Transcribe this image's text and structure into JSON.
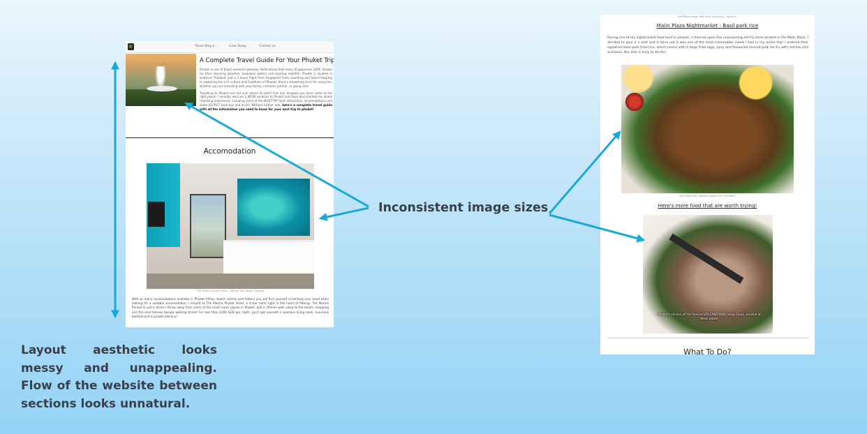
{
  "annotations": {
    "image_sizes_label": "Inconsistent image sizes",
    "layout_note": "Layout aesthetic looks messy and unappealing. Flow of the website between sections looks unnatural.",
    "arrow_color": "#1aa7d9"
  },
  "left_mockup": {
    "nav": {
      "items": [
        "Travel Blog",
        "Case Study",
        "Contact Us"
      ]
    },
    "title": "A Complete Travel Guide For Your Phuket Trip",
    "intro_p1": "Phuket is one of those weekend getaway destinations that every Singaporean LOVE. Known for their stunning beaches, turquoise waters and buzzing nightlife, Phuket is located in southern Thailand, just a 2 hours flight from Singapore! From snorkling and island hopping to exploring the rich culture and traditions of Phuket, there's something here for everyone, whether you are travelling with your family, romantic partner, or going solo!",
    "intro_p2": "Travelling to Phuket and not sure where to start? Fret not, because you have come to the right place! I recently went on a 4D3N vacation to Phuket and have documented my whole travelling experience, including some of the MUST-TRY food, attractions, accomodations and some SECRET local tips and tricks! Without further ado,",
    "intro_p2_bold": "here's a complete travel guide with all the information you need to know for your next trip to phuket!",
    "section_heading": "Accomodation",
    "hotel_caption": "The Marina Phuket Hotel - Deluxe Twin Room (Patong)",
    "body": "With so many accomodations availabe in Phuket (Villas, beach resorts and hotels) you will find yourself scratching your head when looking for a suitable accomodation. I stayed at The Marina Phuket Hotel, a 4-star hotel right in the heart of Patong. The Marina Phuket is just a stone's throw away from some of the most iconic places in Phuket. Just a 10mins walk away to the beach, shopping and the ever-famous bangla walking street! For less than $100 SGD per night, you'll get yourself a spacious living room, luxurious bathtub and a private balcony!"
  },
  "right_mockup": {
    "top_caption": "Jerk Basil dearr fish their (volcano), yummy!",
    "heading_link": "Malin Plaza Nightmarket - Basil pork rice",
    "paragraph": "During one of my nightmarket food-hunt in phuket, I chanced upon this unassuming stir-fry store located in the Malin Plaza. I decided to give it a shot and it turns out it was one of the most memorable meals I had in my entire trip! I ordered their signature basil pork fried rice, which comes with 2 large fried eggs. Juicy and flavourful minced pork stir-fry with red-hot chili and basil, this dish is truly to die-for!",
    "food_caption": "Pork Basil Rice, definitly worth the 100 Baht!!",
    "more_food_link": "Here's more food that are worth trying!",
    "ribs_caption": "Phuket's version of the famous VOLCANO RIBS (Leng Saap), located at Malin plaza!",
    "next_heading": "What To Do?"
  }
}
